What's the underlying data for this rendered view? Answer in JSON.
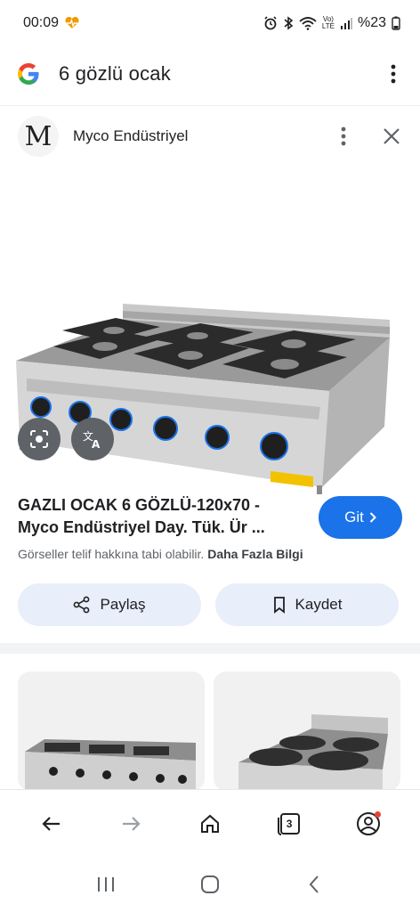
{
  "status_bar": {
    "time": "00:09",
    "battery": "%23",
    "lte_label": "LTE"
  },
  "search": {
    "query": "6 gözlü ocak"
  },
  "result": {
    "site_logo_letter": "M",
    "site_name": "Myco Endüstriyel",
    "title": "GAZLI OCAK 6 GÖZLÜ-120x70 - Myco Endüstriyel Day. Tük. Ür ...",
    "visit_label": "Git",
    "copyright_text": "Görseller telif hakkına tabi olabilir.",
    "more_info": "Daha Fazla Bilgi",
    "share_label": "Paylaş",
    "save_label": "Kaydet"
  },
  "toolbar": {
    "tab_count": "3"
  },
  "colors": {
    "accent": "#1a73e8",
    "pill_bg": "#e8eefa",
    "icon_bg": "#5f6368"
  }
}
